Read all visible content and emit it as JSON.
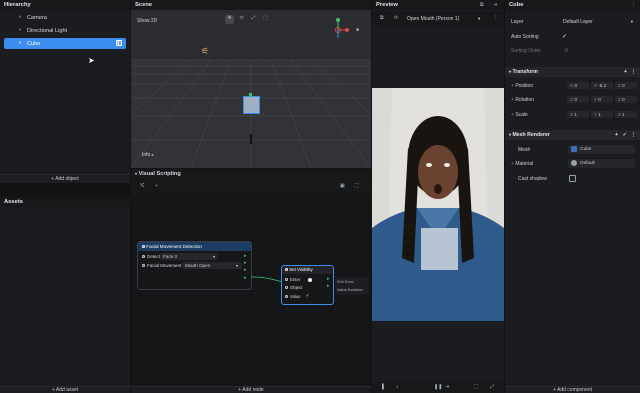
{
  "hierarchy": {
    "title": "Hierarchy",
    "items": [
      "Camera",
      "Directional Light",
      "Cube"
    ],
    "add_label": "+ Add object"
  },
  "assets": {
    "title": "Assets",
    "add_label": "+ Add asset"
  },
  "scene": {
    "title": "Scene",
    "show2d": "Show 2D",
    "info": "Info"
  },
  "visual": {
    "title": "Visual Scripting",
    "add_label": "+ Add node",
    "node1": {
      "title": "Facial Movement Detection",
      "detect_label": "Detect",
      "detect_value": "Face 0",
      "movement_label": "Facial Movement",
      "movement_value": "Mouth Open"
    },
    "node2": {
      "title": "Set Visibility",
      "enter": "Enter",
      "object": "Object",
      "value": "Value",
      "exit": "Exit Exec",
      "boolean": "Value Boolean"
    }
  },
  "preview": {
    "title": "Preview",
    "dropdown": "Open Mouth (Person 1)"
  },
  "inspector": {
    "object_name": "Cube",
    "layer_label": "Layer",
    "layer_value": "Default Layer",
    "auto_sorting": "Auto Sorting",
    "sorting_order": "Sorting Order",
    "sorting_value": "0",
    "transform": "Transform",
    "position": "Position",
    "rotation": "Rotation",
    "scale": "Scale",
    "pos": [
      "0",
      "-8.2",
      "0"
    ],
    "rot": [
      "0",
      "0",
      "0"
    ],
    "scl": [
      "1",
      "1",
      "1"
    ],
    "axes": [
      "X",
      "Y",
      "Z"
    ],
    "mesh_renderer": "Mesh Renderer",
    "mesh_label": "Mesh",
    "mesh_value": "Cube",
    "material_label": "Material",
    "material_value": "Default",
    "cast_shadow": "Cast shadow",
    "add_label": "+ Add component"
  },
  "colors": {
    "accent": "#3b8ef0",
    "node_header": "#1c3d63",
    "green": "#3fc26b"
  }
}
